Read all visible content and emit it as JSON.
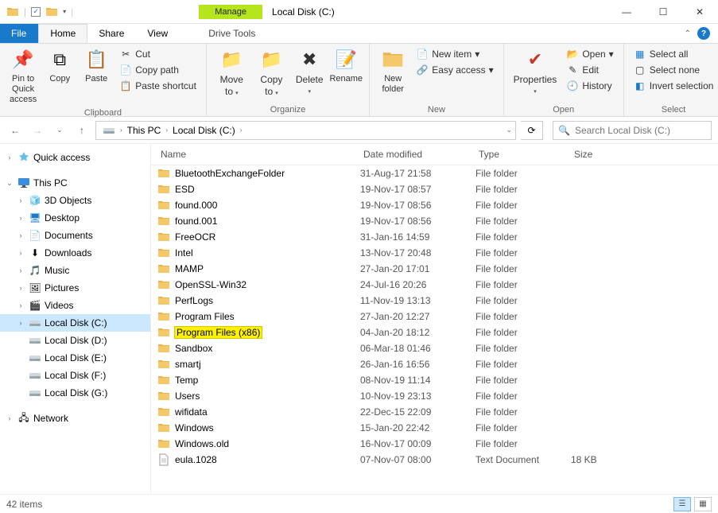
{
  "title": "Local Disk (C:)",
  "titlebar": {
    "manage": "Manage"
  },
  "tabs": {
    "file": "File",
    "home": "Home",
    "share": "Share",
    "view": "View",
    "drivetools": "Drive Tools"
  },
  "ribbon": {
    "clipboard": {
      "label": "Clipboard",
      "pin": "Pin to Quick access",
      "copy": "Copy",
      "paste": "Paste",
      "cut": "Cut",
      "copypath": "Copy path",
      "pasteshortcut": "Paste shortcut"
    },
    "organize": {
      "label": "Organize",
      "moveto": "Move to",
      "copyto": "Copy to",
      "delete": "Delete",
      "rename": "Rename"
    },
    "new": {
      "label": "New",
      "newfolder": "New folder",
      "newitem": "New item",
      "easyaccess": "Easy access"
    },
    "open": {
      "label": "Open",
      "properties": "Properties",
      "open": "Open",
      "edit": "Edit",
      "history": "History"
    },
    "select": {
      "label": "Select",
      "selectall": "Select all",
      "selectnone": "Select none",
      "invert": "Invert selection"
    }
  },
  "breadcrumb": {
    "thispc": "This PC",
    "disk": "Local Disk (C:)"
  },
  "search": {
    "placeholder": "Search Local Disk (C:)"
  },
  "tree": {
    "quickaccess": "Quick access",
    "thispc": "This PC",
    "objects3d": "3D Objects",
    "desktop": "Desktop",
    "documents": "Documents",
    "downloads": "Downloads",
    "music": "Music",
    "pictures": "Pictures",
    "videos": "Videos",
    "diskC": "Local Disk (C:)",
    "diskD": "Local Disk (D:)",
    "diskE": "Local Disk (E:)",
    "diskF": "Local Disk (F:)",
    "diskG": "Local Disk (G:)",
    "network": "Network"
  },
  "columns": {
    "name": "Name",
    "date": "Date modified",
    "type": "Type",
    "size": "Size"
  },
  "files": [
    {
      "name": "BluetoothExchangeFolder",
      "date": "31-Aug-17 21:58",
      "type": "File folder",
      "size": "",
      "icon": "folder"
    },
    {
      "name": "ESD",
      "date": "19-Nov-17 08:57",
      "type": "File folder",
      "size": "",
      "icon": "folder"
    },
    {
      "name": "found.000",
      "date": "19-Nov-17 08:56",
      "type": "File folder",
      "size": "",
      "icon": "folder"
    },
    {
      "name": "found.001",
      "date": "19-Nov-17 08:56",
      "type": "File folder",
      "size": "",
      "icon": "folder"
    },
    {
      "name": "FreeOCR",
      "date": "31-Jan-16 14:59",
      "type": "File folder",
      "size": "",
      "icon": "folder"
    },
    {
      "name": "Intel",
      "date": "13-Nov-17 20:48",
      "type": "File folder",
      "size": "",
      "icon": "folder"
    },
    {
      "name": "MAMP",
      "date": "27-Jan-20 17:01",
      "type": "File folder",
      "size": "",
      "icon": "folder"
    },
    {
      "name": "OpenSSL-Win32",
      "date": "24-Jul-16 20:26",
      "type": "File folder",
      "size": "",
      "icon": "folder"
    },
    {
      "name": "PerfLogs",
      "date": "11-Nov-19 13:13",
      "type": "File folder",
      "size": "",
      "icon": "folder"
    },
    {
      "name": "Program Files",
      "date": "27-Jan-20 12:27",
      "type": "File folder",
      "size": "",
      "icon": "folder"
    },
    {
      "name": "Program Files (x86)",
      "date": "04-Jan-20 18:12",
      "type": "File folder",
      "size": "",
      "icon": "folder",
      "highlight": true
    },
    {
      "name": "Sandbox",
      "date": "06-Mar-18 01:46",
      "type": "File folder",
      "size": "",
      "icon": "folder"
    },
    {
      "name": "smartj",
      "date": "26-Jan-16 16:56",
      "type": "File folder",
      "size": "",
      "icon": "folder"
    },
    {
      "name": "Temp",
      "date": "08-Nov-19 11:14",
      "type": "File folder",
      "size": "",
      "icon": "folder"
    },
    {
      "name": "Users",
      "date": "10-Nov-19 23:13",
      "type": "File folder",
      "size": "",
      "icon": "folder"
    },
    {
      "name": "wifidata",
      "date": "22-Dec-15 22:09",
      "type": "File folder",
      "size": "",
      "icon": "folder"
    },
    {
      "name": "Windows",
      "date": "15-Jan-20 22:42",
      "type": "File folder",
      "size": "",
      "icon": "folder"
    },
    {
      "name": "Windows.old",
      "date": "16-Nov-17 00:09",
      "type": "File folder",
      "size": "",
      "icon": "folder"
    },
    {
      "name": "eula.1028",
      "date": "07-Nov-07 08:00",
      "type": "Text Document",
      "size": "18 KB",
      "icon": "file"
    }
  ],
  "status": {
    "count": "42 items"
  }
}
